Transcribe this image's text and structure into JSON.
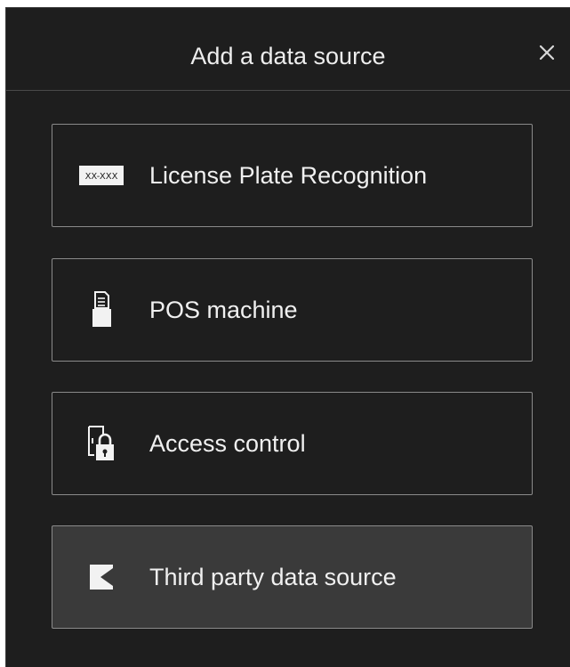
{
  "dialog": {
    "title": "Add a data source",
    "close_icon": "close-icon"
  },
  "options": [
    {
      "label": "License Plate Recognition",
      "icon": "license-plate-icon",
      "icon_text": "XX-XXX"
    },
    {
      "label": "POS machine",
      "icon": "pos-machine-icon"
    },
    {
      "label": "Access control",
      "icon": "access-control-lock-icon"
    },
    {
      "label": "Third party data source",
      "icon": "third-party-source-icon"
    }
  ],
  "colors": {
    "background": "#1e1e1e",
    "border": "#8a8a8a",
    "highlight": "#3a3a3a",
    "text": "#f0f0f0"
  }
}
